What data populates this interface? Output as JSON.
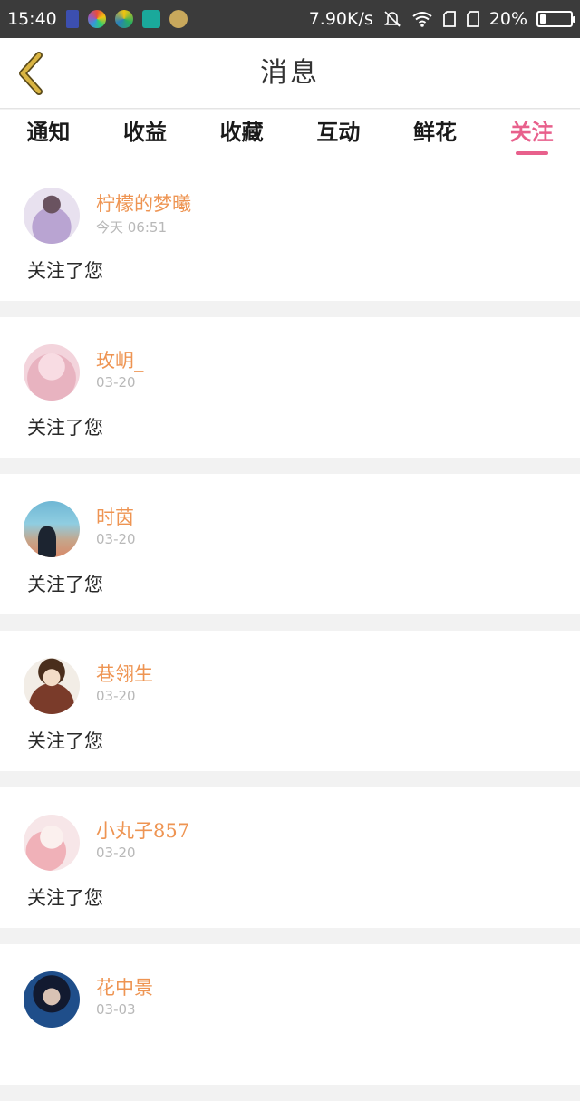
{
  "status_bar": {
    "time": "15:40",
    "network_speed": "7.90K/s",
    "battery_percent": "20%",
    "battery_level": 0.2,
    "icons": [
      "notification-app-icon",
      "color-wheel-icon",
      "chrome-like-icon",
      "scan-icon",
      "avatar-app-icon",
      "mute-vibrate-icon",
      "wifi-icon",
      "sim1-icon",
      "sim2-icon",
      "battery-icon"
    ]
  },
  "header": {
    "title": "消息",
    "back_icon": "chevron-left-icon",
    "accent_color": "#c9a23a"
  },
  "tabs": [
    {
      "label": "通知",
      "active": false
    },
    {
      "label": "收益",
      "active": false
    },
    {
      "label": "收藏",
      "active": false
    },
    {
      "label": "互动",
      "active": false
    },
    {
      "label": "鲜花",
      "active": false
    },
    {
      "label": "关注",
      "active": true
    }
  ],
  "colors": {
    "active_tab": "#e8608c",
    "username": "#ee9452",
    "timestamp": "#b8b8b8"
  },
  "messages": [
    {
      "name": "柠檬的梦曦",
      "time": "今天 06:51",
      "text": "关注了您"
    },
    {
      "name": "玫岄_",
      "time": "03-20",
      "text": "关注了您"
    },
    {
      "name": "时茵",
      "time": "03-20",
      "text": "关注了您"
    },
    {
      "name": "巷翎生",
      "time": "03-20",
      "text": "关注了您"
    },
    {
      "name": "小丸子857",
      "time": "03-20",
      "text": "关注了您"
    },
    {
      "name": "花中景",
      "time": "03-03",
      "text": ""
    }
  ]
}
